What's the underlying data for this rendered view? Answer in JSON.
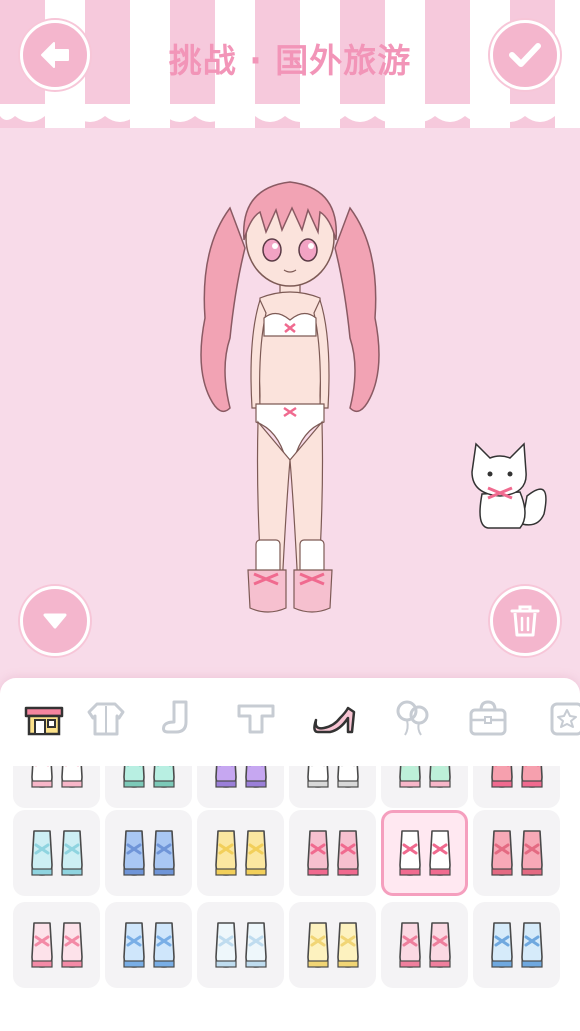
{
  "header": {
    "title": "挑战 · 国外旅游",
    "back_icon": "arrow-left-icon",
    "confirm_icon": "checkmark-icon"
  },
  "stage": {
    "collapse_icon": "triangle-down-icon",
    "trash_icon": "trash-icon"
  },
  "tabs": [
    {
      "name": "shop",
      "icon": "shop-icon",
      "active": true
    },
    {
      "name": "coat",
      "icon": "coat-icon",
      "active": false
    },
    {
      "name": "socks",
      "icon": "sock-icon",
      "active": false
    },
    {
      "name": "tops",
      "icon": "shirt-icon",
      "active": false
    },
    {
      "name": "shoes",
      "icon": "high-heel-icon",
      "active": false
    },
    {
      "name": "balloons",
      "icon": "balloon-icon",
      "active": false
    },
    {
      "name": "bags",
      "icon": "bag-icon",
      "active": false
    },
    {
      "name": "accessories",
      "icon": "star-box-icon",
      "active": false
    }
  ],
  "colors": {
    "accent": "#f4b6cd",
    "accent_dark": "#f295b8",
    "background": "#f8dbe9",
    "selected_border": "#f59fbe"
  },
  "shoe_grid": {
    "selected_row": 1,
    "selected_col": 4,
    "rows": [
      [
        "bunny-slippers-white",
        "bunny-slippers-mint",
        "boots-purple",
        "paw-slippers",
        "socks-mint-pink",
        "shoes-red-ribbon"
      ],
      [
        "ruffle-boots-mint",
        "bow-boots-blue",
        "bow-boots-yellow",
        "platform-shoes-pink",
        "platform-sandals-bow",
        "lace-boots-pink"
      ],
      [
        "sneakers-pink",
        "sneakers-blue",
        "bunny-boots-clear",
        "lace-boots-yellow",
        "sandals-pink",
        "sandals-blue"
      ]
    ]
  }
}
